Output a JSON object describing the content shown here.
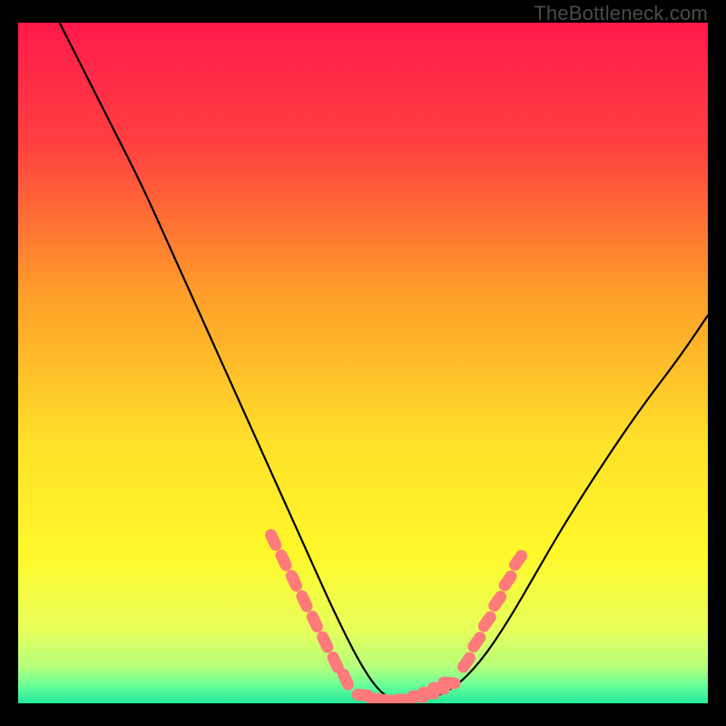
{
  "watermark": "TheBottleneck.com",
  "chart_data": {
    "type": "line",
    "title": "",
    "xlabel": "",
    "ylabel": "",
    "xlim": [
      0,
      100
    ],
    "ylim": [
      0,
      100
    ],
    "grid": false,
    "legend": false,
    "gradient_stops": [
      {
        "offset": 0.0,
        "color": "#ff1a4b"
      },
      {
        "offset": 0.18,
        "color": "#ff4040"
      },
      {
        "offset": 0.4,
        "color": "#ff9f2a"
      },
      {
        "offset": 0.62,
        "color": "#ffe12a"
      },
      {
        "offset": 0.78,
        "color": "#fff82a"
      },
      {
        "offset": 0.89,
        "color": "#e8ff5a"
      },
      {
        "offset": 0.945,
        "color": "#b8ff7a"
      },
      {
        "offset": 0.975,
        "color": "#66ff9a"
      },
      {
        "offset": 1.0,
        "color": "#20e89a"
      }
    ],
    "series": [
      {
        "name": "curve",
        "type": "line",
        "color": "#000000",
        "x": [
          6,
          10,
          14,
          18,
          22,
          26,
          30,
          34,
          38,
          42,
          46,
          50,
          53,
          56,
          59,
          63,
          67,
          71,
          75,
          79,
          84,
          90,
          96,
          100
        ],
        "y": [
          100,
          92,
          84,
          76,
          67,
          58,
          49,
          40,
          31,
          22,
          13,
          5,
          1,
          0,
          0.5,
          2,
          6,
          12,
          19,
          26,
          34,
          43,
          51,
          57
        ]
      },
      {
        "name": "markers-left",
        "type": "scatter",
        "color": "#ff7a7a",
        "x": [
          37,
          38.5,
          40,
          41.5,
          43,
          44.5,
          46,
          47.5
        ],
        "y": [
          24,
          21,
          18,
          15,
          12,
          9,
          6,
          3.5
        ]
      },
      {
        "name": "markers-bottom",
        "type": "scatter",
        "color": "#ff7a7a",
        "x": [
          50,
          52,
          54,
          56,
          58,
          59.5,
          61,
          62.5
        ],
        "y": [
          1.2,
          0.6,
          0.4,
          0.5,
          1,
          1.5,
          2.2,
          3
        ]
      },
      {
        "name": "markers-right",
        "type": "scatter",
        "color": "#ff7a7a",
        "x": [
          65,
          66.5,
          68,
          69.5,
          71,
          72.5
        ],
        "y": [
          6,
          9,
          12,
          15,
          18,
          21
        ]
      }
    ]
  }
}
